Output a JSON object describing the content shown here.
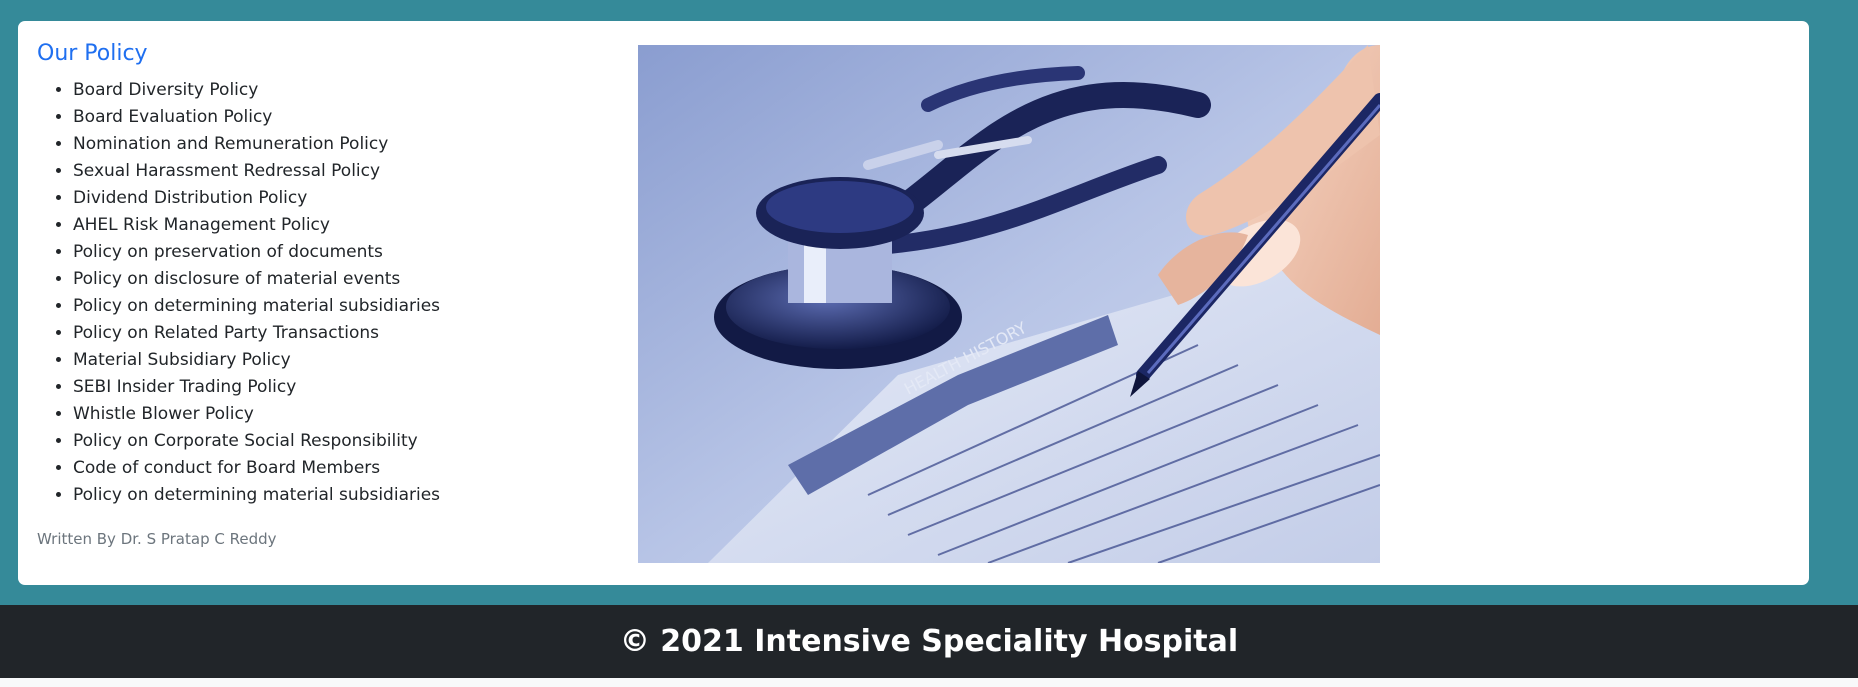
{
  "policy_section": {
    "title": "Our Policy",
    "items": [
      "Board Diversity Policy",
      "Board Evaluation Policy",
      "Nomination and Remuneration Policy",
      "Sexual Harassment Redressal Policy",
      "Dividend Distribution Policy",
      "AHEL Risk Management Policy",
      "Policy on preservation of documents",
      "Policy on disclosure of material events",
      "Policy on determining material subsidiaries",
      "Policy on Related Party Transactions",
      "Material Subsidiary Policy",
      "SEBI Insider Trading Policy",
      "Whistle Blower Policy",
      "Policy on Corporate Social Responsibility",
      "Code of conduct for Board Members",
      "Policy on determining material subsidiaries"
    ],
    "author": "Written By Dr. S Pratap C Reddy"
  },
  "hero_image": {
    "form_label": "HEALTH HISTORY"
  },
  "footer": {
    "copyright": "© 2021 Intensive Speciality Hospital"
  },
  "colors": {
    "page_background": "#358a99",
    "title_blue": "#1f6ff0",
    "footer_background": "#212529"
  }
}
